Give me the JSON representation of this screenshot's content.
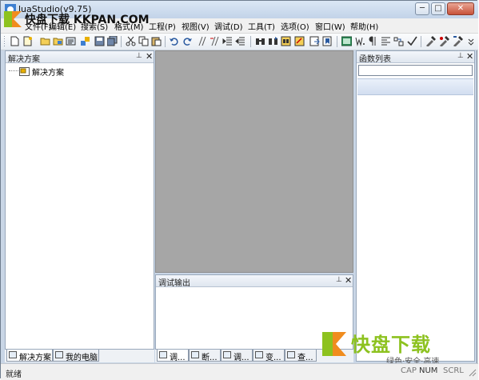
{
  "window": {
    "title": "luaStudio(v9.75)"
  },
  "watermark": {
    "text": "快盘下载 KKPAN.COM"
  },
  "menu": [
    "文件(F)",
    "编辑(E)",
    "搜索(S)",
    "格式(M)",
    "工程(P)",
    "视图(V)",
    "调试(D)",
    "工具(T)",
    "选项(O)",
    "窗口(W)",
    "帮助(H)"
  ],
  "solution_pane": {
    "title": "解决方案",
    "tree_root": "解决方案",
    "tabs": [
      "解决方案",
      "我的电脑"
    ]
  },
  "function_pane": {
    "title": "函数列表",
    "search_value": ""
  },
  "debug_pane": {
    "title": "调试输出",
    "tabs": [
      "调...",
      "断...",
      "调...",
      "变...",
      "查..."
    ]
  },
  "brand_badge": {
    "main": "快盘下载",
    "sub": "绿色·安全·高速",
    "green": "#8dc21f",
    "orange": "#f08c1e"
  },
  "status": {
    "text": "就绪",
    "indicators": [
      "CAP",
      "NUM",
      "SCRL"
    ]
  }
}
